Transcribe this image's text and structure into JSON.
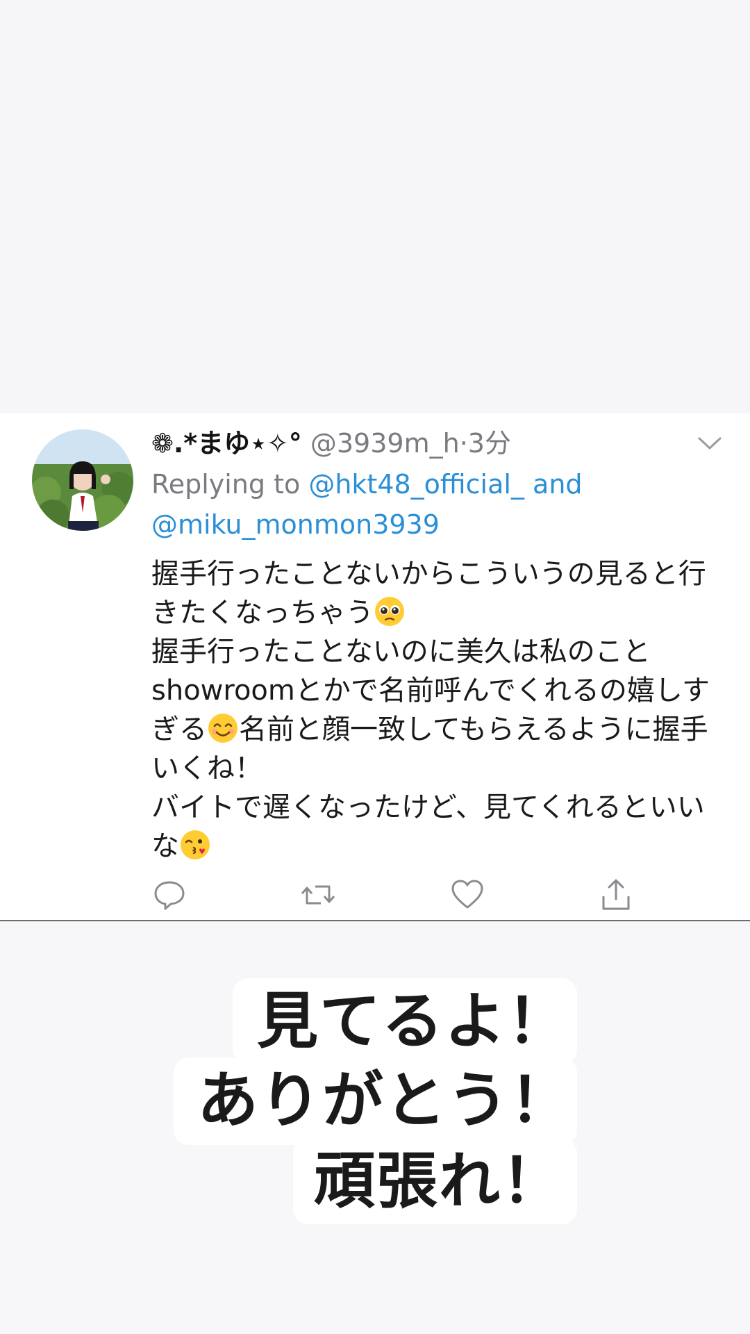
{
  "tweet": {
    "display_name": "❁.*まゆ⋆✧°",
    "handle": "@3939m_h",
    "separator": "·",
    "time": "3分",
    "replying_prefix": "Replying to",
    "reply_mention_1": "@hkt48_official_",
    "reply_and": "and",
    "reply_mention_2": "@miku_monmon3939",
    "text_1": "握手行ったことないからこういうの見ると行きたくなっちゃう",
    "text_2": "握手行ったことないのに美久は私のことshowroomとかで名前呼んでくれるの嬉しすぎる",
    "text_3": "名前と顔一致してもらえるように握手いくね！\nバイトで遅くなったけど、見てくれるといいな",
    "emoji_1": "pleading-face-emoji",
    "emoji_2": "smiling-face-emoji",
    "emoji_3": "face-blowing-kiss-emoji"
  },
  "actions": {
    "reply_icon": "reply-icon",
    "retweet_icon": "retweet-icon",
    "like_icon": "heart-icon",
    "share_icon": "share-icon"
  },
  "overlay": {
    "line_1": "見てるよ！",
    "line_2": "ありがとう！",
    "line_3": "頑張れ！"
  },
  "colors": {
    "mention": "#2a8fd6",
    "secondary_text": "#7a7a80",
    "background": "#f6f6f8"
  }
}
